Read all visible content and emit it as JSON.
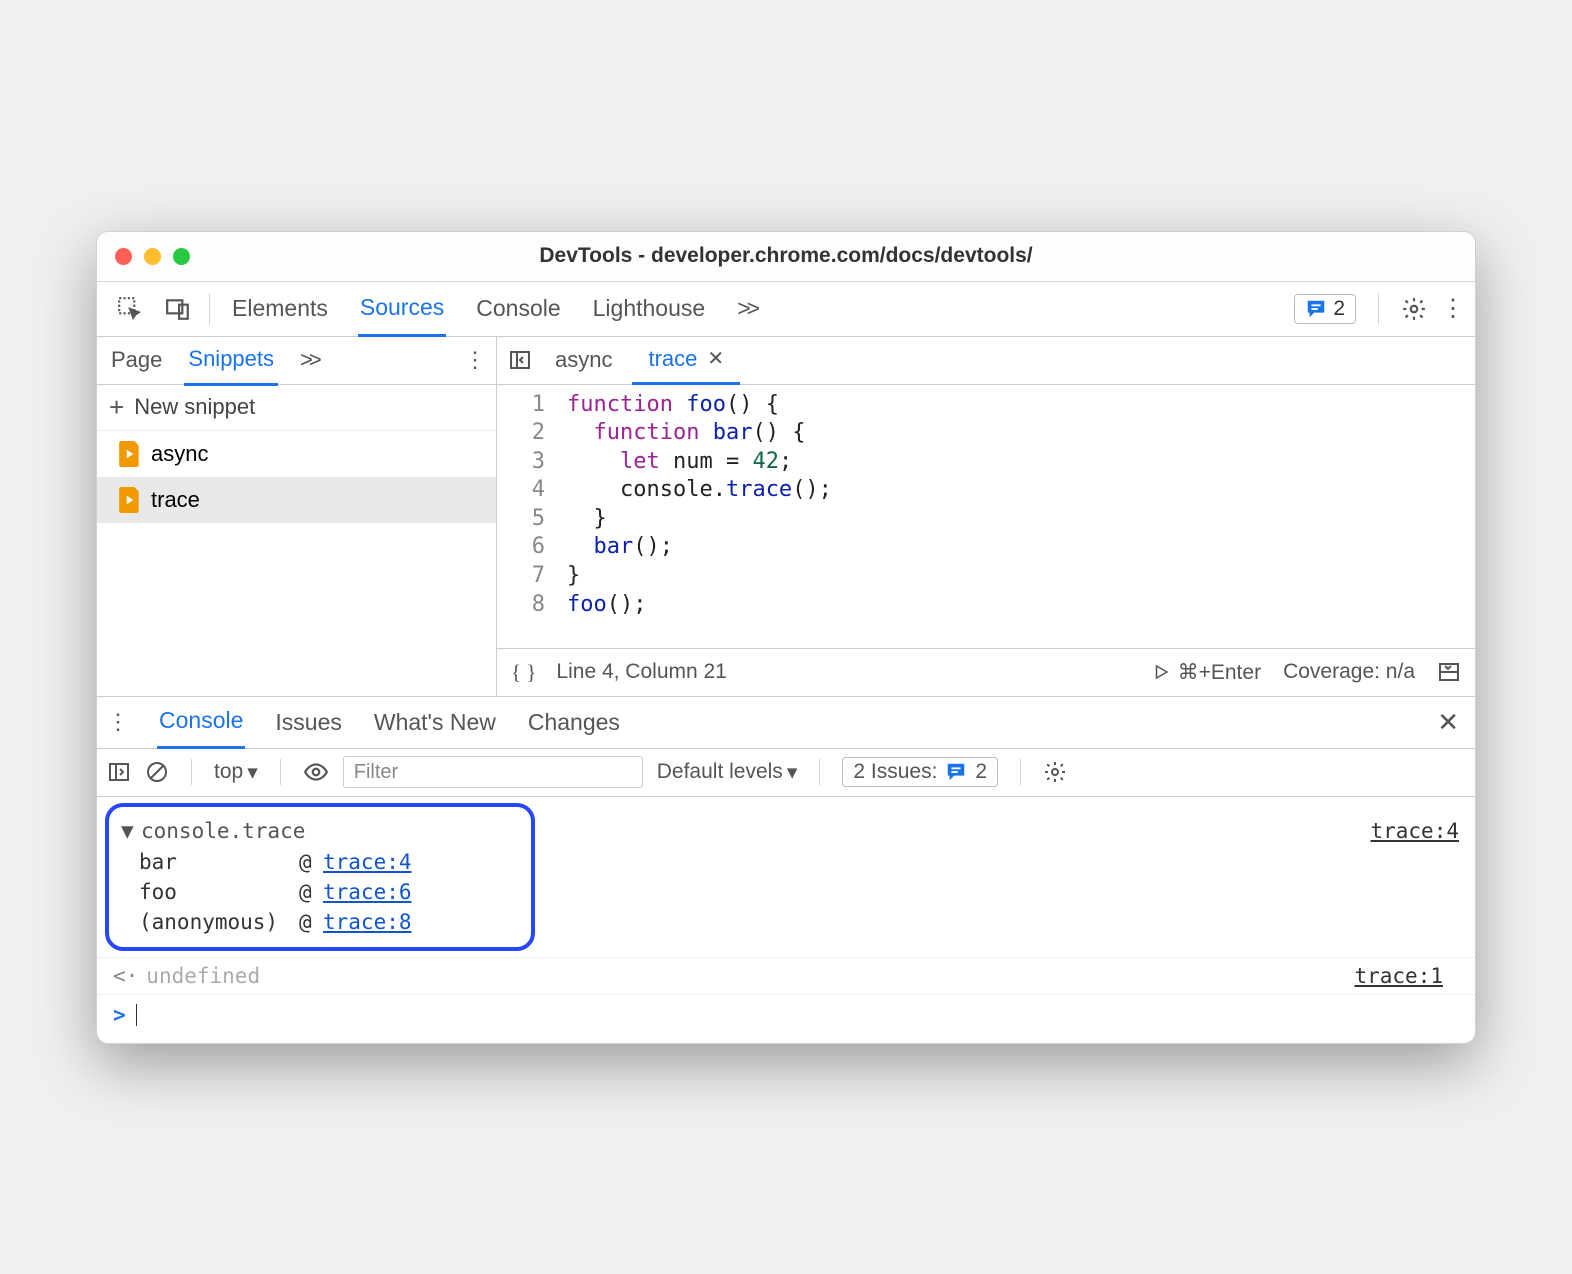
{
  "window": {
    "title": "DevTools - developer.chrome.com/docs/devtools/"
  },
  "toolbar": {
    "tabs": [
      "Elements",
      "Sources",
      "Console",
      "Lighthouse"
    ],
    "active": "Sources",
    "more": ">>",
    "issues_count": "2"
  },
  "sidebar": {
    "tabs": [
      "Page",
      "Snippets"
    ],
    "active": "Snippets",
    "more": ">>",
    "new_label": "New snippet",
    "files": [
      "async",
      "trace"
    ],
    "selected": "trace"
  },
  "editor": {
    "tabs": [
      {
        "name": "async",
        "active": false
      },
      {
        "name": "trace",
        "active": true
      }
    ],
    "lines": [
      "1",
      "2",
      "3",
      "4",
      "5",
      "6",
      "7",
      "8"
    ],
    "code_html": "<span class='kw'>function</span> <span class='fn'>foo</span>() {\n  <span class='kw'>function</span> <span class='fn'>bar</span>() {\n    <span class='kw'>let</span> num = <span class='num'>42</span>;\n    console.<span class='fn'>trace</span>();\n  }\n  <span class='fn'>bar</span>();\n}\n<span class='fn'>foo</span>();",
    "status": {
      "format": "{ }",
      "pos": "Line 4, Column 21",
      "run": "⌘+Enter",
      "coverage": "Coverage: n/a"
    }
  },
  "drawer": {
    "tabs": [
      "Console",
      "Issues",
      "What's New",
      "Changes"
    ],
    "active": "Console"
  },
  "console_toolbar": {
    "context": "top",
    "filter_placeholder": "Filter",
    "levels": "Default levels",
    "issues_label": "2 Issues:",
    "issues_count": "2"
  },
  "console": {
    "trace_label": "console.trace",
    "trace_src": "trace:4",
    "stack": [
      {
        "fn": "bar",
        "at": "@",
        "link": "trace:4"
      },
      {
        "fn": "foo",
        "at": "@",
        "link": "trace:6"
      },
      {
        "fn": "(anonymous)",
        "at": "@",
        "link": "trace:8"
      }
    ],
    "return_value": "undefined",
    "return_src": "trace:1"
  }
}
